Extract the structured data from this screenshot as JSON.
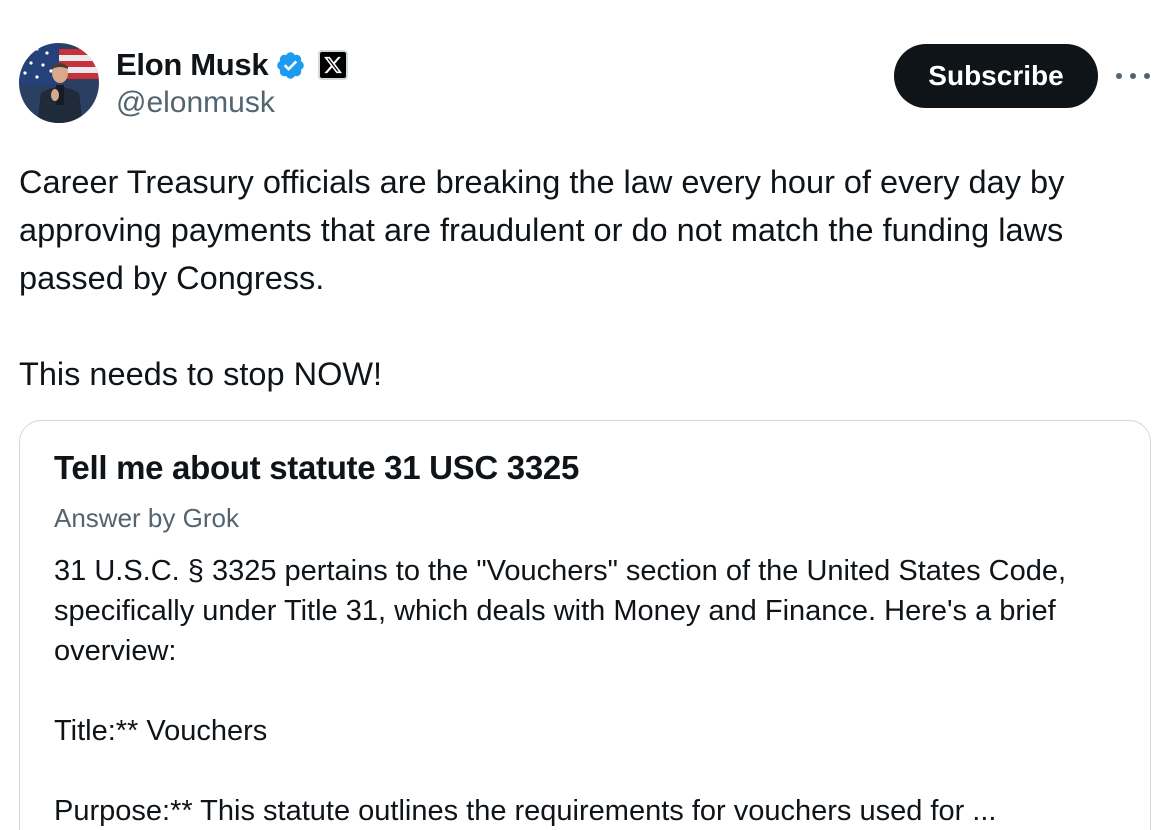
{
  "author": {
    "display_name": "Elon Musk",
    "handle": "@elonmusk",
    "verified_icon": "verified-badge-icon",
    "affiliation_icon": "x-logo-icon"
  },
  "actions": {
    "subscribe_label": "Subscribe",
    "more_icon": "more-options-icon"
  },
  "post": {
    "line1": "Career Treasury officials are breaking the law every hour of every day by approving payments that are fraudulent or do not match the funding laws passed by Congress.",
    "line2": "This needs to stop NOW!"
  },
  "quoted_card": {
    "title": "Tell me about statute 31 USC 3325",
    "subtitle": "Answer by Grok",
    "paragraph1": "31 U.S.C. § 3325 pertains to the \"Vouchers\" section of the United States Code, specifically under Title 31, which deals with Money and Finance. Here's a brief overview:",
    "paragraph2": "Title:** Vouchers",
    "paragraph3": "Purpose:** This statute outlines the requirements for vouchers used for ..."
  },
  "colors": {
    "text_primary": "#0f1419",
    "text_secondary": "#536471",
    "verified_blue": "#1d9bf0",
    "border": "#cfd9de",
    "button_bg": "#0f1419"
  }
}
